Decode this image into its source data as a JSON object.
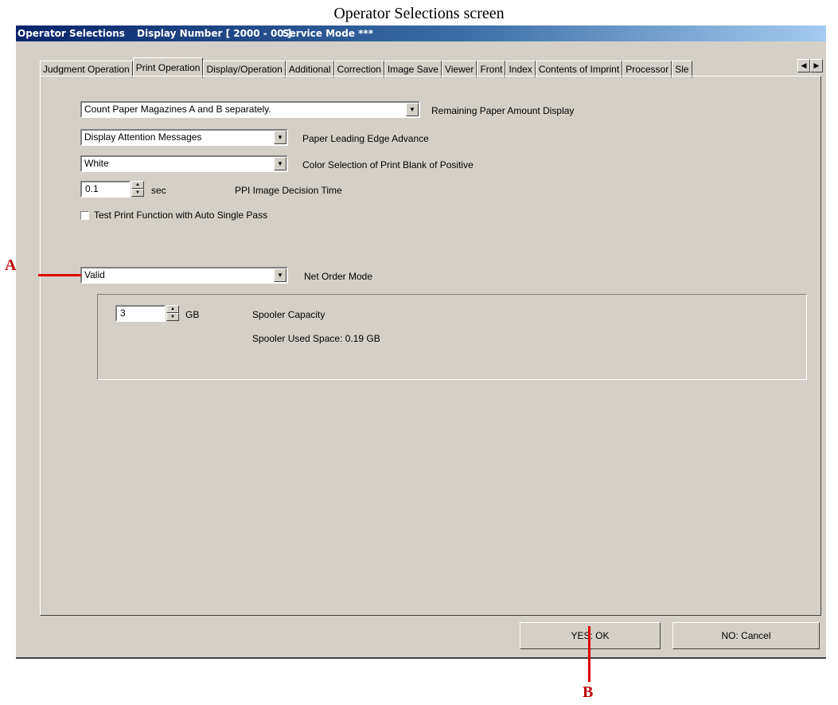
{
  "caption": "Operator Selections screen",
  "window": {
    "title": "Operator Selections",
    "display_number": "Display Number [ 2000 - 00 ]",
    "service_mode": "Service Mode ***"
  },
  "tabs": [
    {
      "label": "Judgment Operation",
      "active": false
    },
    {
      "label": "Print Operation",
      "active": true
    },
    {
      "label": "Display/Operation",
      "active": false
    },
    {
      "label": "Additional",
      "active": false
    },
    {
      "label": "Correction",
      "active": false
    },
    {
      "label": "Image Save",
      "active": false
    },
    {
      "label": "Viewer",
      "active": false
    },
    {
      "label": "Front",
      "active": false
    },
    {
      "label": "Index",
      "active": false
    },
    {
      "label": "Contents of Imprint",
      "active": false
    },
    {
      "label": "Processor",
      "active": false
    },
    {
      "label": "Sle",
      "active": false
    }
  ],
  "settings": {
    "remaining_paper": {
      "value": "Count Paper Magazines A and B separately.",
      "label": "Remaining Paper Amount Display"
    },
    "leading_edge": {
      "value": "Display Attention Messages",
      "label": "Paper Leading Edge Advance"
    },
    "print_blank": {
      "value": "White",
      "label": "Color Selection of Print Blank of Positive"
    },
    "ppi_time": {
      "value": "0.1",
      "unit": "sec",
      "label": "PPI Image Decision Time"
    },
    "test_print": {
      "label": "Test Print Function with Auto Single Pass",
      "checked": false
    },
    "net_order": {
      "value": "Valid",
      "label": "Net Order Mode"
    },
    "spooler_capacity": {
      "value": "3",
      "unit": "GB",
      "label": "Spooler Capacity"
    },
    "spooler_used": "Spooler Used Space: 0.19 GB"
  },
  "buttons": {
    "ok": "YES: OK",
    "cancel": "NO: Cancel"
  },
  "markers": {
    "a": "A",
    "b": "B"
  },
  "colors": {
    "window_bg": "#d4d0c8",
    "titlebar": "#0a246a",
    "marker": "#c00000"
  }
}
